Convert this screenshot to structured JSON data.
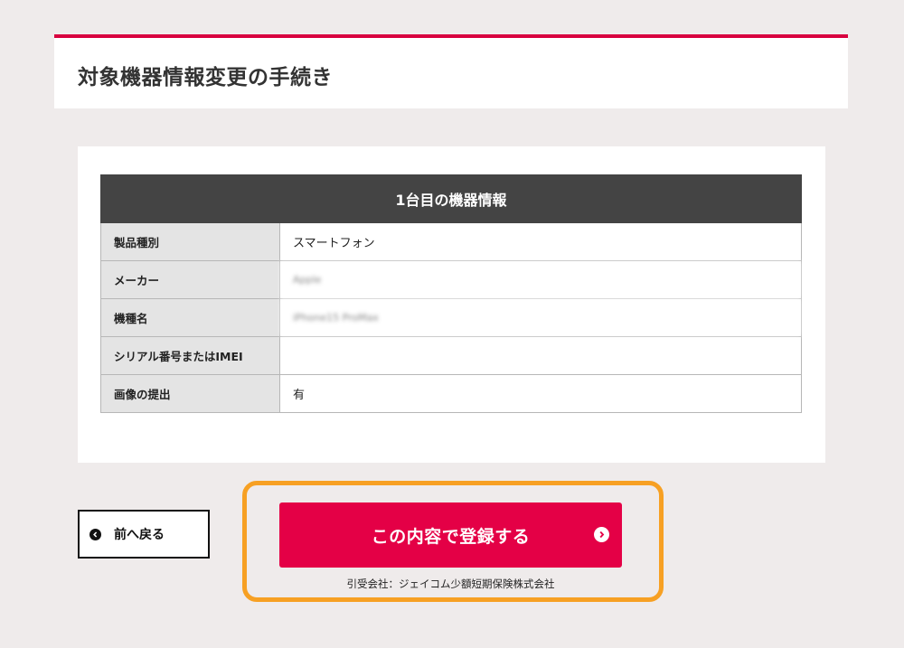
{
  "header": {
    "title": "対象機器情報変更の手続き"
  },
  "device_table": {
    "heading": "1台目の機器情報",
    "rows": [
      {
        "label": "製品種別",
        "value": "スマートフォン"
      },
      {
        "label": "メーカー",
        "value": "Apple"
      },
      {
        "label": "機種名",
        "value": "iPhone15 ProMax"
      },
      {
        "label": "シリアル番号またはIMEI",
        "value": ""
      },
      {
        "label": "画像の提出",
        "value": "有"
      }
    ]
  },
  "actions": {
    "back_label": "前へ戻る",
    "submit_label": "この内容で登録する",
    "underwriter_text": "引受会社：ジェイコム少額短期保険株式会社"
  },
  "colors": {
    "accent": "#e40046",
    "header_rule": "#d8003f",
    "highlight": "#f7a023",
    "table_head": "#444444"
  },
  "icons": {
    "back": "chevron-left-circle-icon",
    "submit": "chevron-right-circle-icon"
  }
}
